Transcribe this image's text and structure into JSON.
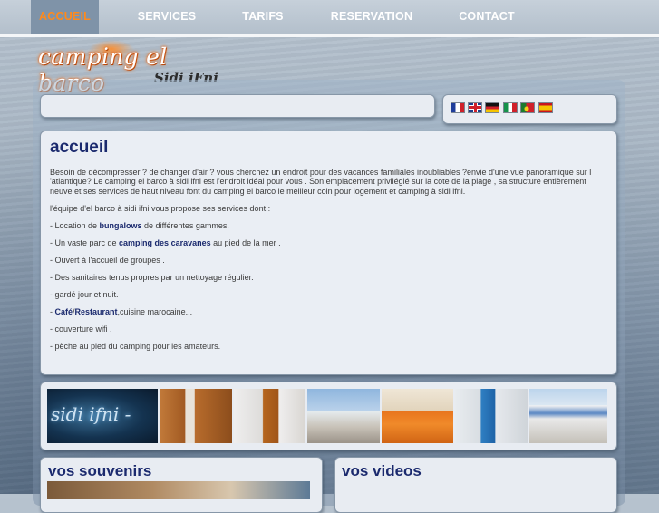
{
  "nav": {
    "items": [
      {
        "label": "ACCUEIL",
        "active": true
      },
      {
        "label": "SERVICES",
        "active": false
      },
      {
        "label": "TARIFS",
        "active": false
      },
      {
        "label": "RESERVATION",
        "active": false
      },
      {
        "label": "CONTACT",
        "active": false
      }
    ],
    "active_color": "#ff8a1c"
  },
  "logo": {
    "main": "camping el barco",
    "sub": "Sidi iFni"
  },
  "languages": [
    {
      "icon": "flag-fr-icon"
    },
    {
      "icon": "flag-uk-icon"
    },
    {
      "icon": "flag-de-icon"
    },
    {
      "icon": "flag-it-icon"
    },
    {
      "icon": "flag-pt-icon"
    },
    {
      "icon": "flag-es-icon"
    }
  ],
  "content": {
    "title": "accueil",
    "intro": "Besoin de décompresser ? de changer d'air ? vous cherchez un endroit pour des vacances familiales inoubliables ?envie d'une vue panoramique sur l 'atlantique? Le camping el barco à sidi ifni est l'endroit idéal pour vous . Son emplacement privilégié sur la cote de la plage , sa structure entièrement neuve et ses services de haut niveau font du camping el barco le meilleur coin pour logement et camping à sidi ifni.",
    "lead": "l'équipe d'el barco à sidi ifni vous propose ses services dont :",
    "services": [
      {
        "pre": "- Location de ",
        "bold": "bungalows",
        "post": " de différentes gammes."
      },
      {
        "pre": "- Un vaste parc de ",
        "bold": "camping des caravanes",
        "post": " au pied de la mer ."
      },
      {
        "pre": "- Ouvert à l'accueil de groupes .",
        "bold": "",
        "post": ""
      },
      {
        "pre": "- Des sanitaires tenus propres par un nettoyage régulier.",
        "bold": "",
        "post": ""
      },
      {
        "pre": "- gardé jour et nuit.",
        "bold": "",
        "post": ""
      },
      {
        "pre": "- ",
        "bold": "Café",
        "sep": "/",
        "bold2": "Restaurant",
        "post": ",cuisine marocaine..."
      },
      {
        "pre": "- couverture wifi .",
        "bold": "",
        "post": ""
      },
      {
        "pre": "- pèche au pied du camping pour les amateurs.",
        "bold": "",
        "post": ""
      }
    ]
  },
  "gallery": {
    "banner_text": "sidi ifni -"
  },
  "sections": {
    "souvenirs": "vos souvenirs",
    "videos": "vos videos"
  }
}
